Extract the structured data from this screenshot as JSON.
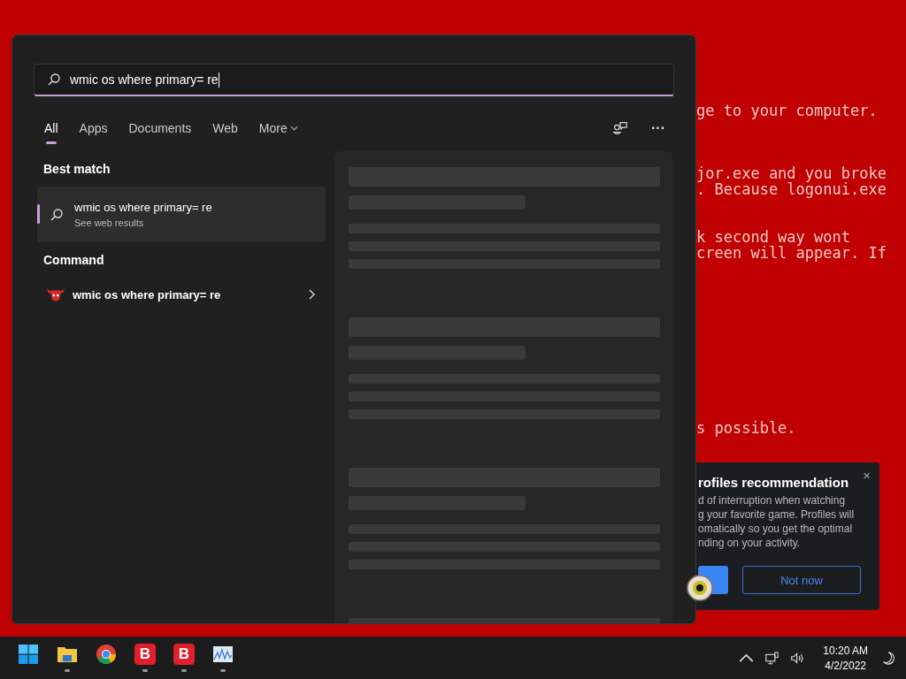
{
  "desktop_text": [
    [
      "ge to your computer."
    ],
    [
      "jor.exe and you broke",
      ". Because logonui.exe"
    ],
    [
      "k second way wont",
      "creen will appear. If"
    ],
    [
      "s possible."
    ]
  ],
  "notification": {
    "title": "rofiles recommendation",
    "body": [
      "d of interruption when watching",
      "g your favorite game. Profiles will",
      "omatically so you get the optimal",
      "nding on your activity."
    ],
    "close": "×",
    "dismiss_button": "Not now"
  },
  "search": {
    "value": "wmic os where primary= re"
  },
  "tabs": [
    {
      "label": "All",
      "selected": true,
      "kind": "tab"
    },
    {
      "label": "Apps",
      "selected": false,
      "kind": "tab"
    },
    {
      "label": "Documents",
      "selected": false,
      "kind": "tab"
    },
    {
      "label": "Web",
      "selected": false,
      "kind": "tab"
    },
    {
      "label": "More",
      "selected": false,
      "kind": "dropdown"
    }
  ],
  "more_menu": "···",
  "best_match": {
    "heading": "Best match",
    "title": "wmic os where primary= re",
    "subtitle": "See web results",
    "selected": true
  },
  "command": {
    "heading": "Command",
    "title": "wmic os where primary= re",
    "selected": false
  },
  "taskbar": {
    "apps": [
      {
        "kind": "start",
        "running": false
      },
      {
        "kind": "folder",
        "running": true
      },
      {
        "kind": "browser",
        "running": false
      },
      {
        "kind": "letter",
        "label": "B",
        "running": true
      },
      {
        "kind": "letter",
        "label": "B",
        "running": true
      },
      {
        "kind": "monitor",
        "running": true
      }
    ],
    "time": "10:20 AM",
    "date": "4/2/2022"
  }
}
